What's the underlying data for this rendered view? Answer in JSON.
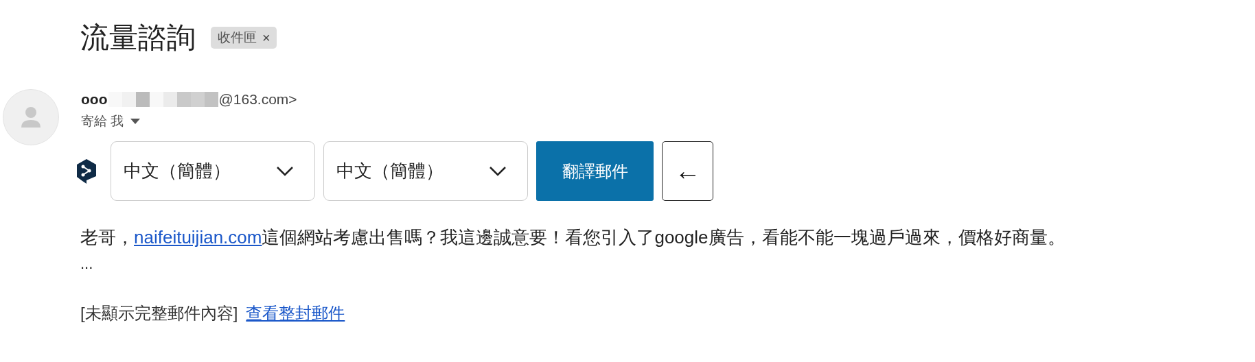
{
  "subject": "流量諮詢",
  "label": {
    "text": "收件匣",
    "remove": "×"
  },
  "sender": {
    "name_start": "ooo",
    "address_end": "@163.com>",
    "redacted": true
  },
  "recipient": {
    "text": "寄給 我"
  },
  "translate": {
    "source": {
      "value": "中文（簡體）"
    },
    "target": {
      "value": "中文（簡體）"
    },
    "button": "翻譯郵件",
    "back": "←"
  },
  "body": {
    "before": "老哥，",
    "link": "naifeituijian.com",
    "after": "這個網站考慮出售嗎？我這邊誠意要！看您引入了google廣告，看能不能一塊過戶過來，價格好商量。",
    "ellipsis": "..."
  },
  "footer": {
    "note": "[未顯示完整郵件內容]",
    "link": "查看整封郵件"
  }
}
